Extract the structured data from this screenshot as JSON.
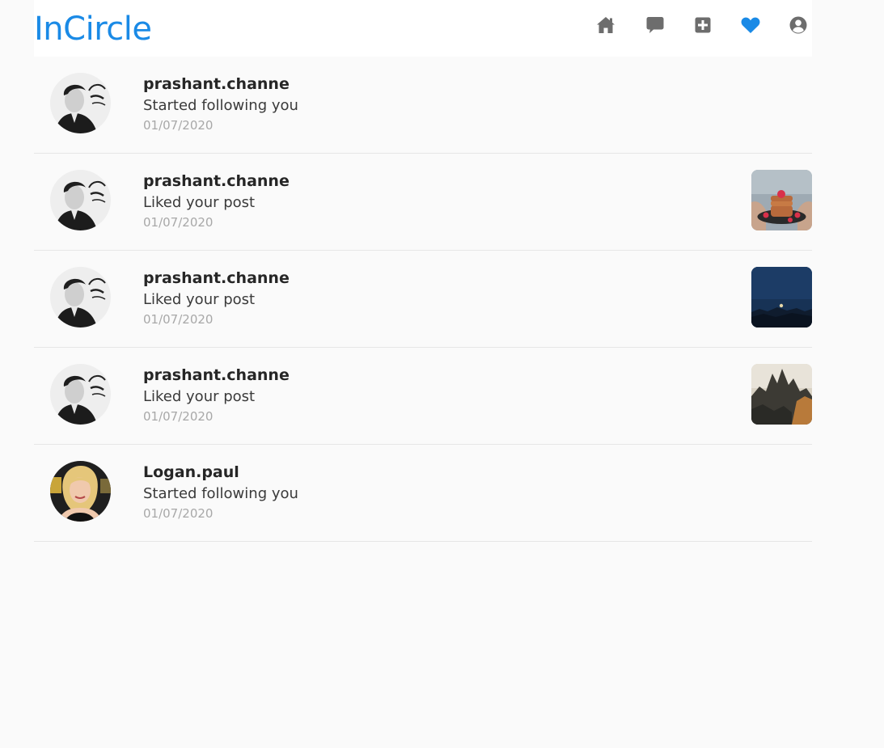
{
  "app": {
    "logo": "InCircle"
  },
  "nav": {
    "icons": [
      "home-icon",
      "chat-icon",
      "plus-square-icon",
      "heart-icon",
      "user-circle-icon"
    ],
    "active": "heart-icon",
    "colors": {
      "inactive": "#6d6d6d",
      "active": "#1a8ae6"
    }
  },
  "notifications": [
    {
      "username": "prashant.channe",
      "message": "Started following you",
      "date": "01/07/2020",
      "avatar": "male-avatar",
      "post_thumbnail": null
    },
    {
      "username": "prashant.channe",
      "message": "Liked your post",
      "date": "01/07/2020",
      "avatar": "male-avatar",
      "post_thumbnail": "pancakes-photo"
    },
    {
      "username": "prashant.channe",
      "message": "Liked your post",
      "date": "01/07/2020",
      "avatar": "male-avatar",
      "post_thumbnail": "night-mountains-photo"
    },
    {
      "username": "prashant.channe",
      "message": "Liked your post",
      "date": "01/07/2020",
      "avatar": "male-avatar",
      "post_thumbnail": "rocky-peaks-photo"
    },
    {
      "username": "Logan.paul",
      "message": "Started following you",
      "date": "01/07/2020",
      "avatar": "female-avatar",
      "post_thumbnail": null
    }
  ]
}
